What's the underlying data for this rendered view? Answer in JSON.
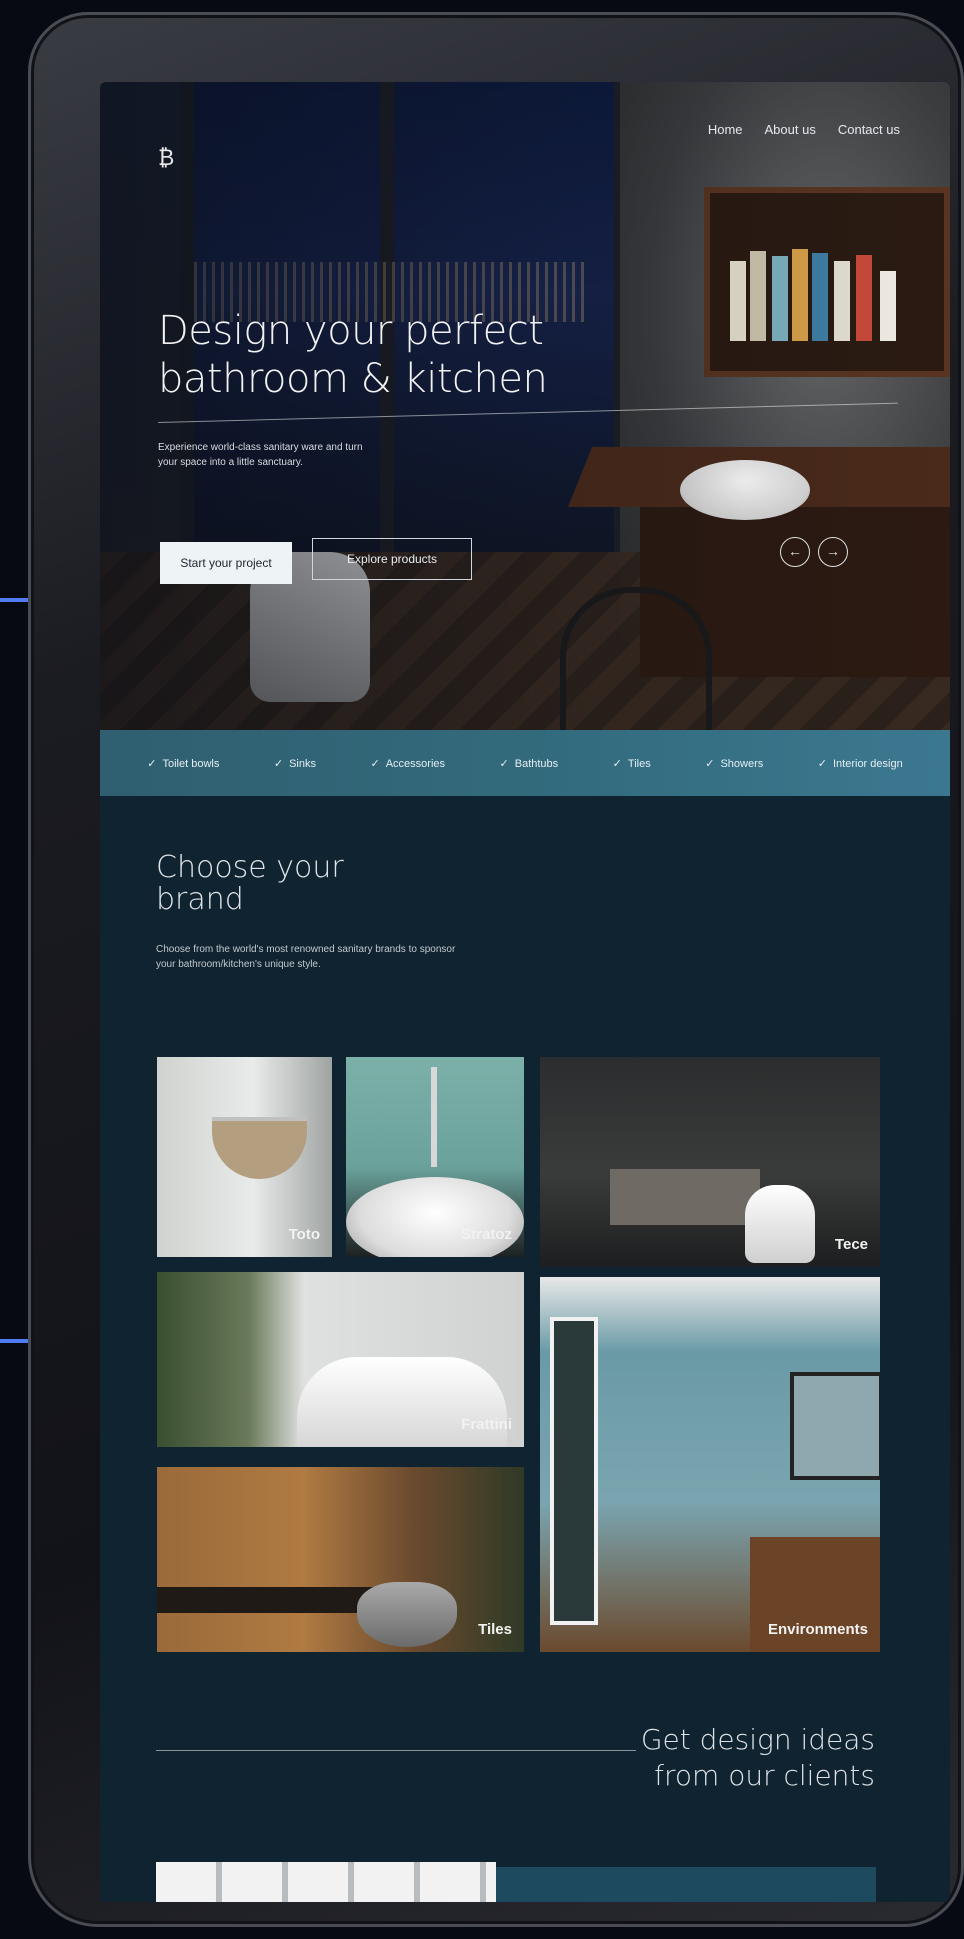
{
  "nav": {
    "items": [
      "Home",
      "About us",
      "Contact us"
    ]
  },
  "hero": {
    "logo_glyph": "₿",
    "title": "Design your perfect bathroom & kitchen",
    "subtitle": "Experience world-class sanitary ware and turn your space into a little sanctuary.",
    "primary_cta": "Start your project",
    "secondary_cta": "Explore products",
    "prev_glyph": "←",
    "next_glyph": "→"
  },
  "categories": {
    "check": "✓",
    "items": [
      "Toilet bowls",
      "Sinks",
      "Accessories",
      "Bathtubs",
      "Tiles",
      "Showers",
      "Interior design"
    ]
  },
  "brands": {
    "title": "Choose your brand",
    "description": "Choose from the world's most renowned sanitary brands to sponsor your bathroom/kitchen's unique style.",
    "tiles": [
      "Toto",
      "Stratoz",
      "Tece",
      "Frattini",
      "Environments",
      "Tiles"
    ]
  },
  "ideas": {
    "title": "Get design ideas from our clients"
  },
  "colors": {
    "accent": "#4f7cf0",
    "strip": "#326a7c",
    "background": "#0f2430"
  }
}
